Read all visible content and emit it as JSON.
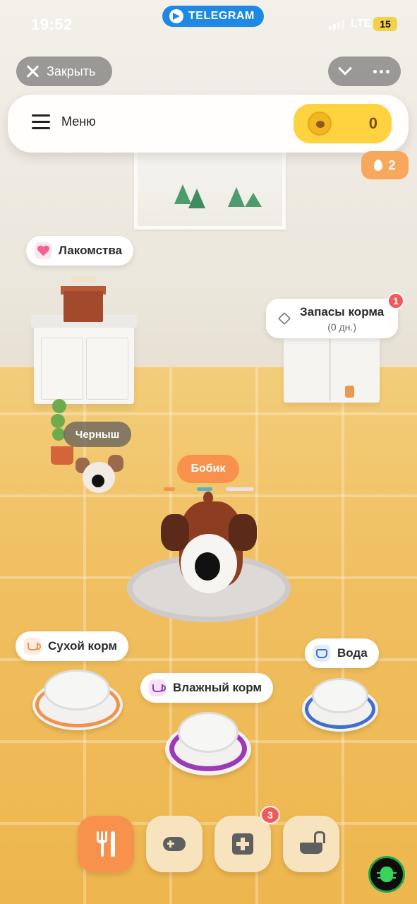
{
  "status_bar": {
    "time": "19:52",
    "telegram_label": "TELEGRAM",
    "network": "LTE",
    "battery": "15"
  },
  "top_controls": {
    "close_label": "Закрыть",
    "menu_label": "Меню",
    "coins": "0",
    "streak": "2"
  },
  "room": {
    "treats_label": "Лакомства",
    "supplies_label": "Запасы корма",
    "supplies_sub": "(0 дн.)",
    "supplies_badge": "1"
  },
  "pets": {
    "other_name": "Черныш",
    "main_name": "Бобик"
  },
  "feeding": {
    "dry_food": "Сухой корм",
    "wet_food": "Влажный корм",
    "water": "Вода"
  },
  "bottom_nav": {
    "items": [
      {
        "name": "feed",
        "icon": "fork-knife-icon",
        "active": true
      },
      {
        "name": "play",
        "icon": "gamepad-icon",
        "active": false
      },
      {
        "name": "health",
        "icon": "medkit-icon",
        "active": false,
        "badge": "3"
      },
      {
        "name": "bath",
        "icon": "bath-icon",
        "active": false
      }
    ],
    "health_badge": "3"
  },
  "colors": {
    "accent_orange": "#f7914b",
    "coin_yellow": "#ffd23f",
    "telegram_blue": "#1e88e5",
    "dry_bowl_ring": "#f0924a",
    "wet_bowl_ring": "#9b3ab8",
    "water_bowl_ring": "#3d6fd1"
  }
}
